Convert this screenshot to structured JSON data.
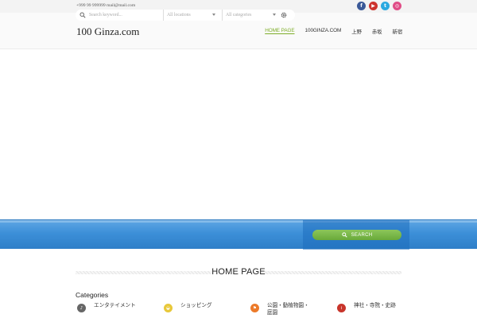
{
  "topbar": {
    "contact": "+999 99 999999 mail@mail.com",
    "socials": [
      {
        "icon": "facebook-icon",
        "glyph": "f",
        "color": "#3b5998"
      },
      {
        "icon": "youtube-icon",
        "glyph": "▶",
        "color": "#cd332d"
      },
      {
        "icon": "twitter-icon",
        "glyph": "t",
        "color": "#2aa9e0"
      },
      {
        "icon": "dribbble-icon",
        "glyph": "◎",
        "color": "#e04c86"
      }
    ]
  },
  "header": {
    "logo": "100 Ginza.com",
    "nav": [
      {
        "label": "HOME PAGE",
        "active": true
      },
      {
        "label": "100GINZA.COM",
        "active": false
      },
      {
        "label": "上野",
        "active": false
      },
      {
        "label": "赤坂",
        "active": false
      },
      {
        "label": "新宿",
        "active": false
      }
    ],
    "accent_color": "#7fae2a"
  },
  "search": {
    "keyword_placeholder": "Search keyword...",
    "location_value": "All locations",
    "category_value": "All categories",
    "button_label": "SEARCH",
    "band_color": "#3c8fd8",
    "button_color": "#69a93a"
  },
  "page": {
    "title": "HOME PAGE",
    "categories_heading": "Categories"
  },
  "categories": [
    {
      "label": "エンタテイメント",
      "icon": "entertainment-icon",
      "glyph": "♪",
      "color": "#666666"
    },
    {
      "label": "ショッピング",
      "icon": "shopping-icon",
      "glyph": "◒",
      "color": "#e8c83a"
    },
    {
      "label": "公園・動植物園・庭園",
      "icon": "park-icon",
      "glyph": "⚑",
      "color": "#ec7a2a"
    },
    {
      "label": "神社・寺院・史跡",
      "icon": "shrine-icon",
      "glyph": "i",
      "color": "#c8352b"
    }
  ]
}
